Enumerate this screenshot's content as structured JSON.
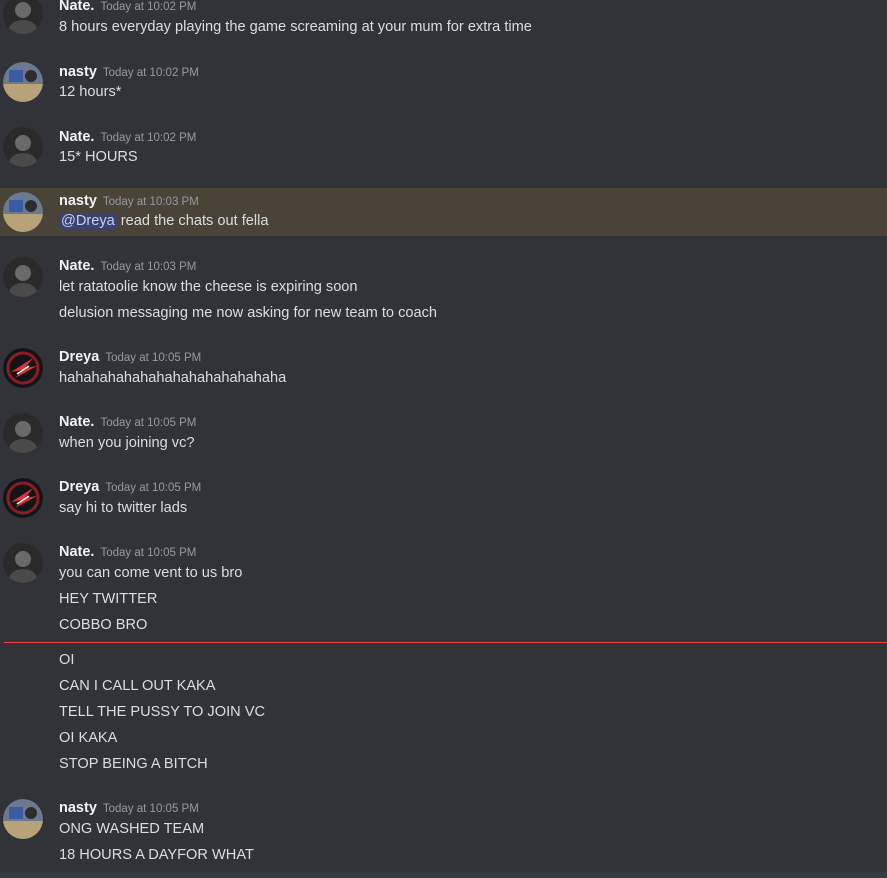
{
  "chat": {
    "messages": [
      {
        "author": "Nate.",
        "time": "Today at 10:02 PM",
        "lines": [
          "8 hours everyday playing the game screaming at your mum for extra time"
        ]
      },
      {
        "author": "nasty",
        "time": "Today at 10:02 PM",
        "lines": [
          "12 hours*"
        ]
      },
      {
        "author": "Nate.",
        "time": "Today at 10:02 PM",
        "lines": [
          "15* HOURS"
        ]
      },
      {
        "author": "nasty",
        "time": "Today at 10:03 PM",
        "mention": "@Dreya",
        "lines": [
          " read the chats out fella"
        ]
      },
      {
        "author": "Nate.",
        "time": "Today at 10:03 PM",
        "lines": [
          "let ratatoolie know the cheese is expiring soon",
          "delusion messaging me now asking for new team to coach"
        ]
      },
      {
        "author": "Dreya",
        "time": "Today at 10:05 PM",
        "lines": [
          "hahahahahahahahahahahahahaha"
        ]
      },
      {
        "author": "Nate.",
        "time": "Today at 10:05 PM",
        "lines": [
          "when you joining vc?"
        ]
      },
      {
        "author": "Dreya",
        "time": "Today at 10:05 PM",
        "lines": [
          "say hi to twitter lads"
        ]
      },
      {
        "author": "Nate.",
        "time": "Today at 10:05 PM",
        "lines": [
          "you can come vent to us bro",
          "HEY TWITTER",
          "COBBO BRO",
          "OI",
          "CAN I CALL OUT KAKA",
          "TELL THE PUSSY TO JOIN VC",
          "OI KAKA",
          "STOP BEING A BITCH"
        ]
      },
      {
        "author": "nasty",
        "time": "Today at 10:05 PM",
        "lines": [
          "ONG WASHED TEAM",
          "18 HOURS A DAYFOR WHAT"
        ]
      }
    ]
  },
  "colors": {
    "background": "#313338",
    "highlight": "#4a4337",
    "mention_bg": "#3c4270",
    "new_divider": "#f23f43"
  }
}
